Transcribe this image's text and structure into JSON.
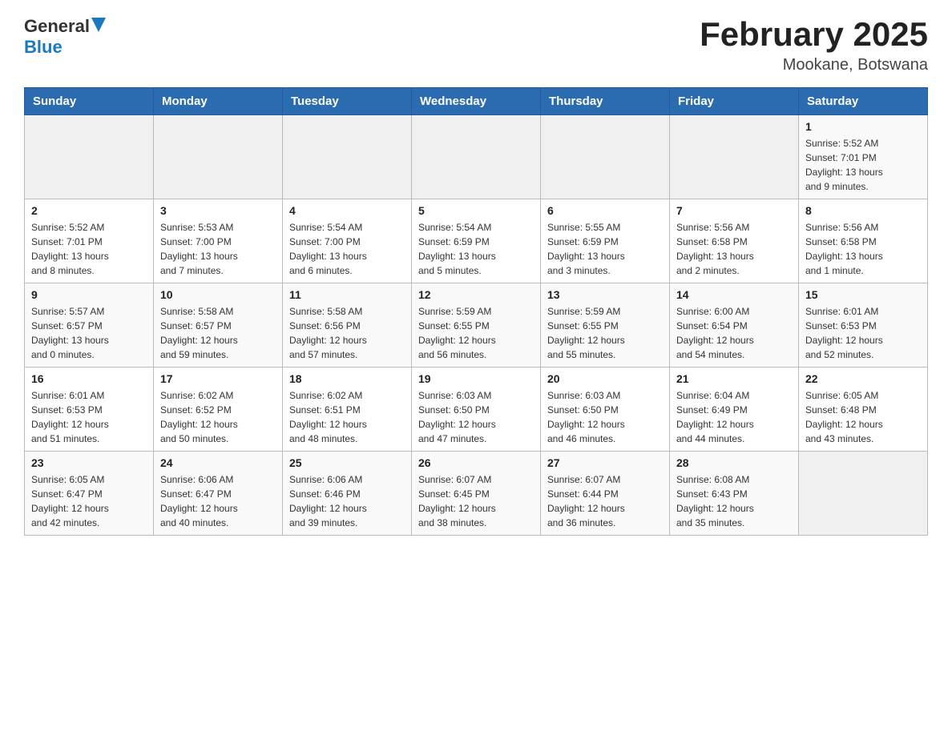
{
  "header": {
    "logo_general": "General",
    "logo_blue": "Blue",
    "title": "February 2025",
    "location": "Mookane, Botswana"
  },
  "days_of_week": [
    "Sunday",
    "Monday",
    "Tuesday",
    "Wednesday",
    "Thursday",
    "Friday",
    "Saturday"
  ],
  "weeks": [
    {
      "days": [
        {
          "number": "",
          "info": ""
        },
        {
          "number": "",
          "info": ""
        },
        {
          "number": "",
          "info": ""
        },
        {
          "number": "",
          "info": ""
        },
        {
          "number": "",
          "info": ""
        },
        {
          "number": "",
          "info": ""
        },
        {
          "number": "1",
          "info": "Sunrise: 5:52 AM\nSunset: 7:01 PM\nDaylight: 13 hours\nand 9 minutes."
        }
      ]
    },
    {
      "days": [
        {
          "number": "2",
          "info": "Sunrise: 5:52 AM\nSunset: 7:01 PM\nDaylight: 13 hours\nand 8 minutes."
        },
        {
          "number": "3",
          "info": "Sunrise: 5:53 AM\nSunset: 7:00 PM\nDaylight: 13 hours\nand 7 minutes."
        },
        {
          "number": "4",
          "info": "Sunrise: 5:54 AM\nSunset: 7:00 PM\nDaylight: 13 hours\nand 6 minutes."
        },
        {
          "number": "5",
          "info": "Sunrise: 5:54 AM\nSunset: 6:59 PM\nDaylight: 13 hours\nand 5 minutes."
        },
        {
          "number": "6",
          "info": "Sunrise: 5:55 AM\nSunset: 6:59 PM\nDaylight: 13 hours\nand 3 minutes."
        },
        {
          "number": "7",
          "info": "Sunrise: 5:56 AM\nSunset: 6:58 PM\nDaylight: 13 hours\nand 2 minutes."
        },
        {
          "number": "8",
          "info": "Sunrise: 5:56 AM\nSunset: 6:58 PM\nDaylight: 13 hours\nand 1 minute."
        }
      ]
    },
    {
      "days": [
        {
          "number": "9",
          "info": "Sunrise: 5:57 AM\nSunset: 6:57 PM\nDaylight: 13 hours\nand 0 minutes."
        },
        {
          "number": "10",
          "info": "Sunrise: 5:58 AM\nSunset: 6:57 PM\nDaylight: 12 hours\nand 59 minutes."
        },
        {
          "number": "11",
          "info": "Sunrise: 5:58 AM\nSunset: 6:56 PM\nDaylight: 12 hours\nand 57 minutes."
        },
        {
          "number": "12",
          "info": "Sunrise: 5:59 AM\nSunset: 6:55 PM\nDaylight: 12 hours\nand 56 minutes."
        },
        {
          "number": "13",
          "info": "Sunrise: 5:59 AM\nSunset: 6:55 PM\nDaylight: 12 hours\nand 55 minutes."
        },
        {
          "number": "14",
          "info": "Sunrise: 6:00 AM\nSunset: 6:54 PM\nDaylight: 12 hours\nand 54 minutes."
        },
        {
          "number": "15",
          "info": "Sunrise: 6:01 AM\nSunset: 6:53 PM\nDaylight: 12 hours\nand 52 minutes."
        }
      ]
    },
    {
      "days": [
        {
          "number": "16",
          "info": "Sunrise: 6:01 AM\nSunset: 6:53 PM\nDaylight: 12 hours\nand 51 minutes."
        },
        {
          "number": "17",
          "info": "Sunrise: 6:02 AM\nSunset: 6:52 PM\nDaylight: 12 hours\nand 50 minutes."
        },
        {
          "number": "18",
          "info": "Sunrise: 6:02 AM\nSunset: 6:51 PM\nDaylight: 12 hours\nand 48 minutes."
        },
        {
          "number": "19",
          "info": "Sunrise: 6:03 AM\nSunset: 6:50 PM\nDaylight: 12 hours\nand 47 minutes."
        },
        {
          "number": "20",
          "info": "Sunrise: 6:03 AM\nSunset: 6:50 PM\nDaylight: 12 hours\nand 46 minutes."
        },
        {
          "number": "21",
          "info": "Sunrise: 6:04 AM\nSunset: 6:49 PM\nDaylight: 12 hours\nand 44 minutes."
        },
        {
          "number": "22",
          "info": "Sunrise: 6:05 AM\nSunset: 6:48 PM\nDaylight: 12 hours\nand 43 minutes."
        }
      ]
    },
    {
      "days": [
        {
          "number": "23",
          "info": "Sunrise: 6:05 AM\nSunset: 6:47 PM\nDaylight: 12 hours\nand 42 minutes."
        },
        {
          "number": "24",
          "info": "Sunrise: 6:06 AM\nSunset: 6:47 PM\nDaylight: 12 hours\nand 40 minutes."
        },
        {
          "number": "25",
          "info": "Sunrise: 6:06 AM\nSunset: 6:46 PM\nDaylight: 12 hours\nand 39 minutes."
        },
        {
          "number": "26",
          "info": "Sunrise: 6:07 AM\nSunset: 6:45 PM\nDaylight: 12 hours\nand 38 minutes."
        },
        {
          "number": "27",
          "info": "Sunrise: 6:07 AM\nSunset: 6:44 PM\nDaylight: 12 hours\nand 36 minutes."
        },
        {
          "number": "28",
          "info": "Sunrise: 6:08 AM\nSunset: 6:43 PM\nDaylight: 12 hours\nand 35 minutes."
        },
        {
          "number": "",
          "info": ""
        }
      ]
    }
  ]
}
